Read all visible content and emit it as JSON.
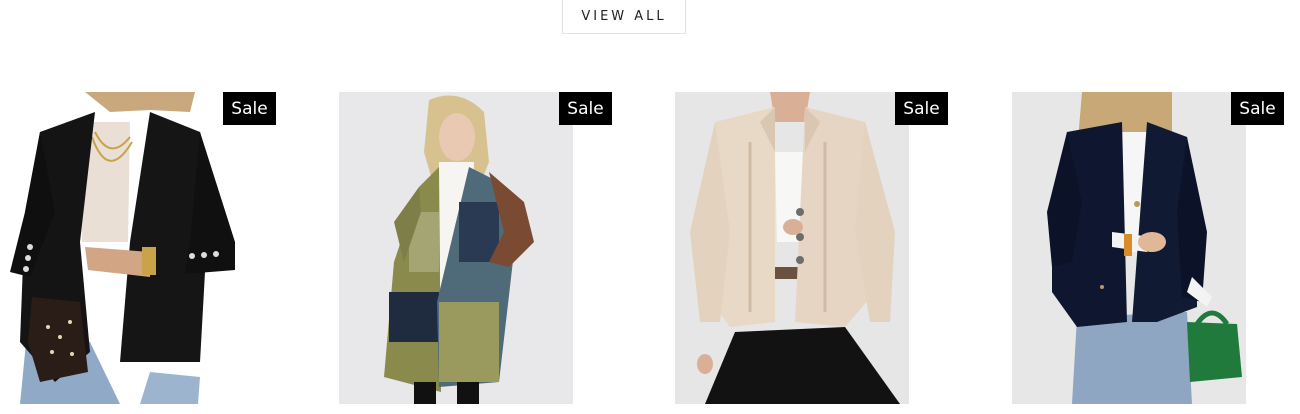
{
  "view_all": {
    "label": "VIEW ALL"
  },
  "products": [
    {
      "badge": "Sale",
      "image_desc": "black-blazer"
    },
    {
      "badge": "Sale",
      "image_desc": "patchwork-cardigan"
    },
    {
      "badge": "Sale",
      "image_desc": "cream-knit-blazer"
    },
    {
      "badge": "Sale",
      "image_desc": "navy-velvet-blazer"
    }
  ],
  "colors": {
    "badge_bg": "#000000",
    "badge_text": "#ffffff"
  }
}
